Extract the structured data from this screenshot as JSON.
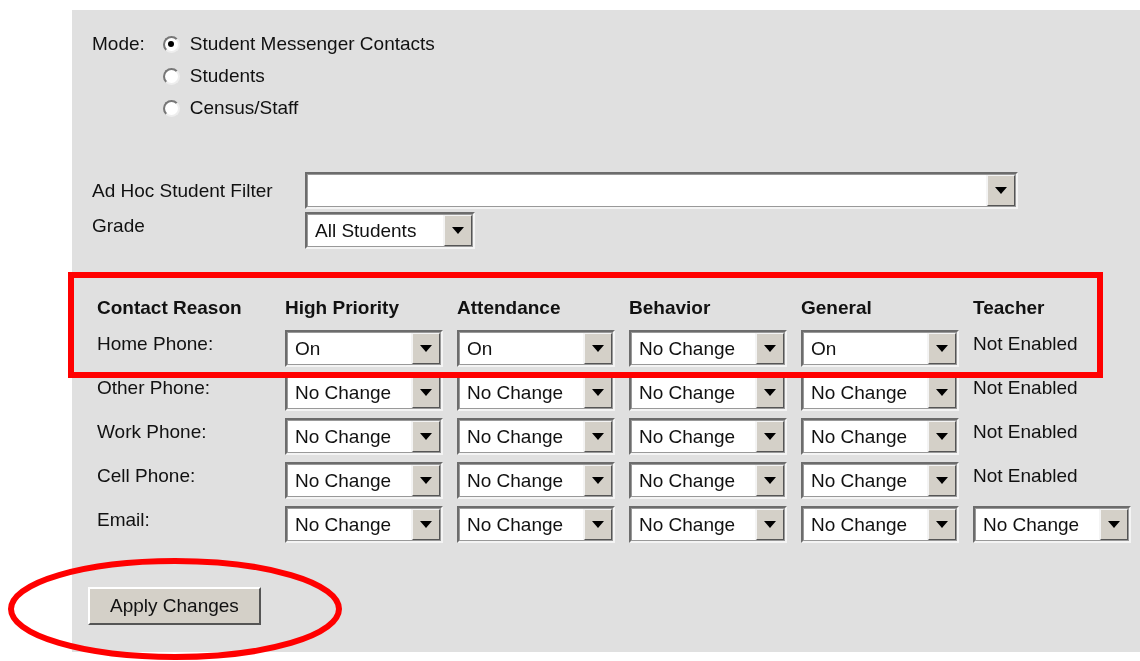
{
  "mode": {
    "label": "Mode:",
    "options": [
      {
        "label": "Student Messenger Contacts",
        "selected": true
      },
      {
        "label": "Students",
        "selected": false
      },
      {
        "label": "Census/Staff",
        "selected": false
      }
    ]
  },
  "filter": {
    "label": "Ad Hoc Student Filter"
  },
  "grade": {
    "label": "Grade",
    "value": "All Students"
  },
  "contacts": {
    "columns": [
      "Contact Reason",
      "High Priority",
      "Attendance",
      "Behavior",
      "General",
      "Teacher"
    ],
    "rows": [
      {
        "cells": [
          {
            "kind": "label",
            "value": "Home Phone:"
          },
          {
            "kind": "select",
            "value": "On"
          },
          {
            "kind": "select",
            "value": "On"
          },
          {
            "kind": "select",
            "value": "No Change"
          },
          {
            "kind": "select",
            "value": "On"
          },
          {
            "kind": "text",
            "value": "Not Enabled"
          }
        ]
      },
      {
        "cells": [
          {
            "kind": "label",
            "value": "Other Phone:"
          },
          {
            "kind": "select",
            "value": "No Change"
          },
          {
            "kind": "select",
            "value": "No Change"
          },
          {
            "kind": "select",
            "value": "No Change"
          },
          {
            "kind": "select",
            "value": "No Change"
          },
          {
            "kind": "text",
            "value": "Not Enabled"
          }
        ]
      },
      {
        "cells": [
          {
            "kind": "label",
            "value": "Work Phone:"
          },
          {
            "kind": "select",
            "value": "No Change"
          },
          {
            "kind": "select",
            "value": "No Change"
          },
          {
            "kind": "select",
            "value": "No Change"
          },
          {
            "kind": "select",
            "value": "No Change"
          },
          {
            "kind": "text",
            "value": "Not Enabled"
          }
        ]
      },
      {
        "cells": [
          {
            "kind": "label",
            "value": "Cell Phone:"
          },
          {
            "kind": "select",
            "value": "No Change"
          },
          {
            "kind": "select",
            "value": "No Change"
          },
          {
            "kind": "select",
            "value": "No Change"
          },
          {
            "kind": "select",
            "value": "No Change"
          },
          {
            "kind": "text",
            "value": "Not Enabled"
          }
        ]
      },
      {
        "cells": [
          {
            "kind": "label",
            "value": "Email:"
          },
          {
            "kind": "select",
            "value": "No Change"
          },
          {
            "kind": "select",
            "value": "No Change"
          },
          {
            "kind": "select",
            "value": "No Change"
          },
          {
            "kind": "select",
            "value": "No Change"
          },
          {
            "kind": "select",
            "value": "No Change"
          }
        ]
      }
    ]
  },
  "apply_button": "Apply Changes",
  "annotations": {
    "box_around_first_row": true,
    "circle_around_button": true
  }
}
